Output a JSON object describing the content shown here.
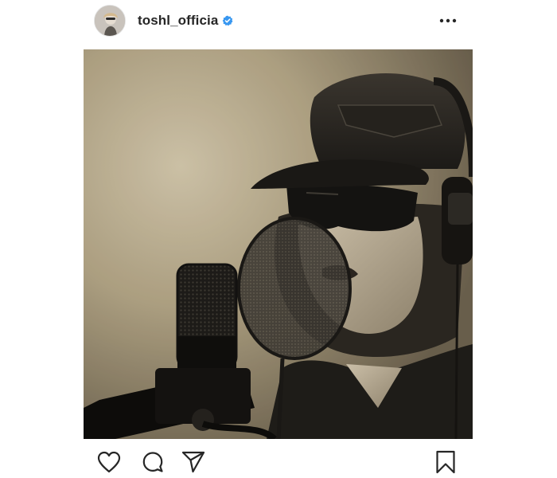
{
  "post": {
    "username": "toshl_officia",
    "verified": true,
    "photo_alt": "",
    "more_icon": "more-horizontal-icon"
  },
  "actions": {
    "like_icon": "heart-icon",
    "comment_icon": "comment-bubble-icon",
    "share_icon": "paper-plane-icon",
    "save_icon": "bookmark-icon"
  },
  "colors": {
    "text": "#262626",
    "verified_blue": "#3897f0",
    "photo_tint": "#8c7f66"
  }
}
